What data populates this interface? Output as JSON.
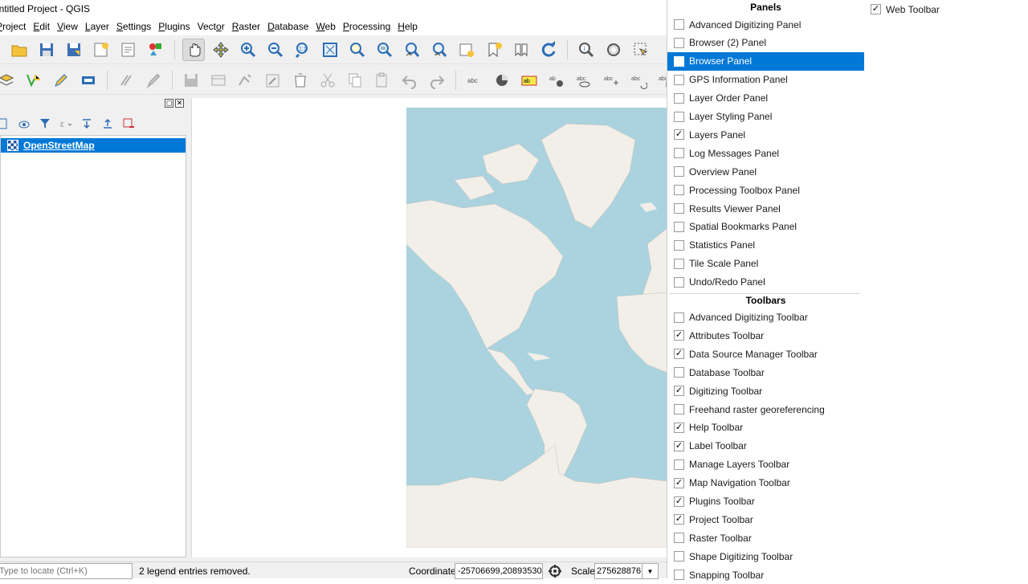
{
  "window": {
    "title": "Untitled Project - QGIS"
  },
  "menubar": [
    {
      "label": "Project",
      "underline": "P"
    },
    {
      "label": "Edit",
      "underline": "E"
    },
    {
      "label": "View",
      "underline": "V"
    },
    {
      "label": "Layer",
      "underline": "L"
    },
    {
      "label": "Settings",
      "underline": "S"
    },
    {
      "label": "Plugins",
      "underline": "P"
    },
    {
      "label": "Vector",
      "underline": "o"
    },
    {
      "label": "Raster",
      "underline": "R"
    },
    {
      "label": "Database",
      "underline": "D"
    },
    {
      "label": "Web",
      "underline": "W"
    },
    {
      "label": "Processing",
      "underline": "P"
    },
    {
      "label": "Help",
      "underline": "H"
    }
  ],
  "layers": {
    "items": [
      {
        "label": "OpenStreetMap",
        "selected": true
      }
    ]
  },
  "statusbar": {
    "locator_placeholder": "Type to locate (Ctrl+K)",
    "message": "2 legend entries removed.",
    "coordinate_label": "Coordinate",
    "coordinate_value": "-25706699,20893530",
    "scale_label": "Scale",
    "scale_value": "275628876"
  },
  "context_menu": {
    "panels_title": "Panels",
    "panels": [
      {
        "label": "Advanced Digitizing Panel",
        "checked": false
      },
      {
        "label": "Browser (2) Panel",
        "checked": false
      },
      {
        "label": "Browser Panel",
        "checked": false,
        "highlighted": true
      },
      {
        "label": "GPS Information Panel",
        "checked": false
      },
      {
        "label": "Layer Order Panel",
        "checked": false
      },
      {
        "label": "Layer Styling Panel",
        "checked": false
      },
      {
        "label": "Layers Panel",
        "checked": true
      },
      {
        "label": "Log Messages Panel",
        "checked": false
      },
      {
        "label": "Overview Panel",
        "checked": false
      },
      {
        "label": "Processing Toolbox Panel",
        "checked": false
      },
      {
        "label": "Results Viewer Panel",
        "checked": false
      },
      {
        "label": "Spatial Bookmarks Panel",
        "checked": false
      },
      {
        "label": "Statistics Panel",
        "checked": false
      },
      {
        "label": "Tile Scale Panel",
        "checked": false
      },
      {
        "label": "Undo/Redo Panel",
        "checked": false
      }
    ],
    "toolbars_title": "Toolbars",
    "toolbars": [
      {
        "label": "Advanced Digitizing Toolbar",
        "checked": false
      },
      {
        "label": "Attributes Toolbar",
        "checked": true
      },
      {
        "label": "Data Source Manager Toolbar",
        "checked": true
      },
      {
        "label": "Database Toolbar",
        "checked": false
      },
      {
        "label": "Digitizing Toolbar",
        "checked": true
      },
      {
        "label": "Freehand raster georeferencing",
        "checked": false
      },
      {
        "label": "Help Toolbar",
        "checked": true
      },
      {
        "label": "Label Toolbar",
        "checked": true
      },
      {
        "label": "Manage Layers Toolbar",
        "checked": false
      },
      {
        "label": "Map Navigation Toolbar",
        "checked": true
      },
      {
        "label": "Plugins Toolbar",
        "checked": true
      },
      {
        "label": "Project Toolbar",
        "checked": true
      },
      {
        "label": "Raster Toolbar",
        "checked": false
      },
      {
        "label": "Shape Digitizing Toolbar",
        "checked": false
      },
      {
        "label": "Snapping Toolbar",
        "checked": false
      }
    ],
    "toolbars_col2": [
      {
        "label": "Web Toolbar",
        "checked": true
      }
    ]
  },
  "colors": {
    "selection": "#0078d7",
    "ocean": "#aad3df",
    "land": "#f2efe9"
  }
}
